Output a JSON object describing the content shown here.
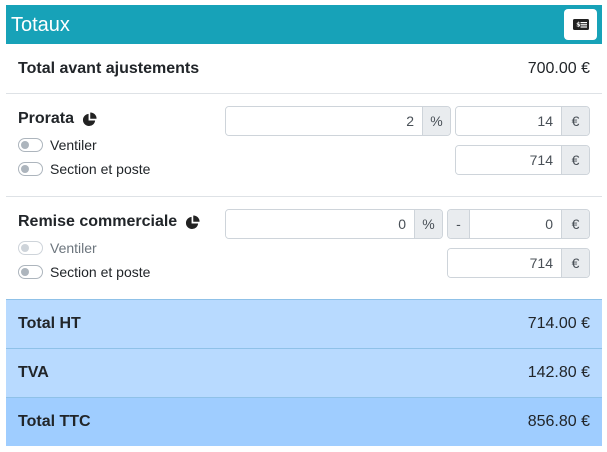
{
  "header": {
    "title": "Totaux",
    "button_icon": "money-bill-list-icon"
  },
  "total_avant": {
    "label": "Total avant ajustements",
    "value": "700.00 €"
  },
  "prorata": {
    "title": "Prorata",
    "title_icon": "pie-chart-icon",
    "percent_value": "2",
    "percent_unit": "%",
    "amount_value": "14",
    "amount_unit": "€",
    "total_value": "714",
    "total_unit": "€",
    "toggles": [
      {
        "label": "Ventiler",
        "disabled": false
      },
      {
        "label": "Section et poste",
        "disabled": false
      }
    ]
  },
  "remise": {
    "title": "Remise commerciale",
    "title_icon": "pie-chart-icon",
    "percent_value": "0",
    "percent_unit": "%",
    "amount_prefix": "-",
    "amount_value": "0",
    "amount_unit": "€",
    "total_value": "714",
    "total_unit": "€",
    "toggles": [
      {
        "label": "Ventiler",
        "disabled": true
      },
      {
        "label": "Section et poste",
        "disabled": false
      }
    ]
  },
  "totals": [
    {
      "label": "Total HT",
      "value": "714.00 €",
      "color": "#b8daff"
    },
    {
      "label": "TVA",
      "value": "142.80 €",
      "color": "#b8daff"
    },
    {
      "label": "Total TTC",
      "value": "856.80 €",
      "color": "#9fcdff"
    }
  ]
}
